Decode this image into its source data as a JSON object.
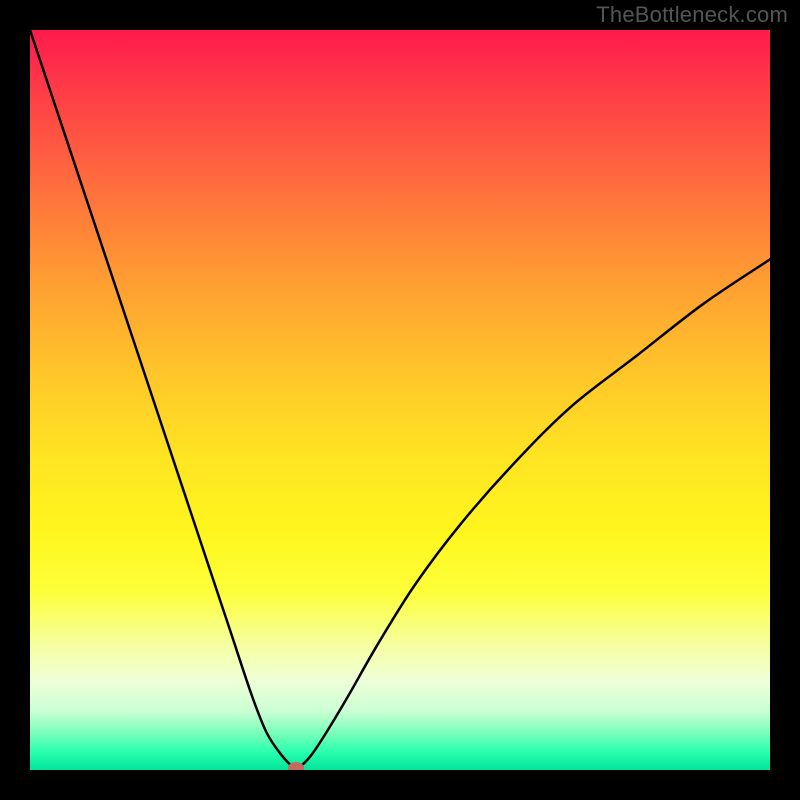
{
  "watermark": "TheBottleneck.com",
  "chart_data": {
    "type": "line",
    "title": "",
    "xlabel": "",
    "ylabel": "",
    "xlim": [
      0,
      100
    ],
    "ylim": [
      0,
      100
    ],
    "grid": false,
    "legend": false,
    "series": [
      {
        "name": "bottleneck-curve",
        "x": [
          0,
          3,
          6,
          9,
          12,
          15,
          18,
          21,
          24,
          27,
          30,
          32,
          34,
          35.5,
          36.5,
          38,
          40,
          43,
          47,
          52,
          58,
          65,
          73,
          82,
          91,
          100
        ],
        "y": [
          100,
          91,
          82,
          73,
          64,
          55,
          46,
          37,
          28,
          19,
          10,
          5,
          2,
          0.5,
          0.5,
          2,
          5,
          10,
          17,
          25,
          33,
          41,
          49,
          56,
          63,
          69
        ]
      }
    ],
    "minimum_point": {
      "x": 36,
      "y": 0.3
    },
    "colors": {
      "curve": "#000000",
      "dot": "#c66a5f",
      "frame": "#000000",
      "gradient_top": "#ff1a4d",
      "gradient_mid": "#fff61e",
      "gradient_bottom": "#00e59a"
    }
  }
}
